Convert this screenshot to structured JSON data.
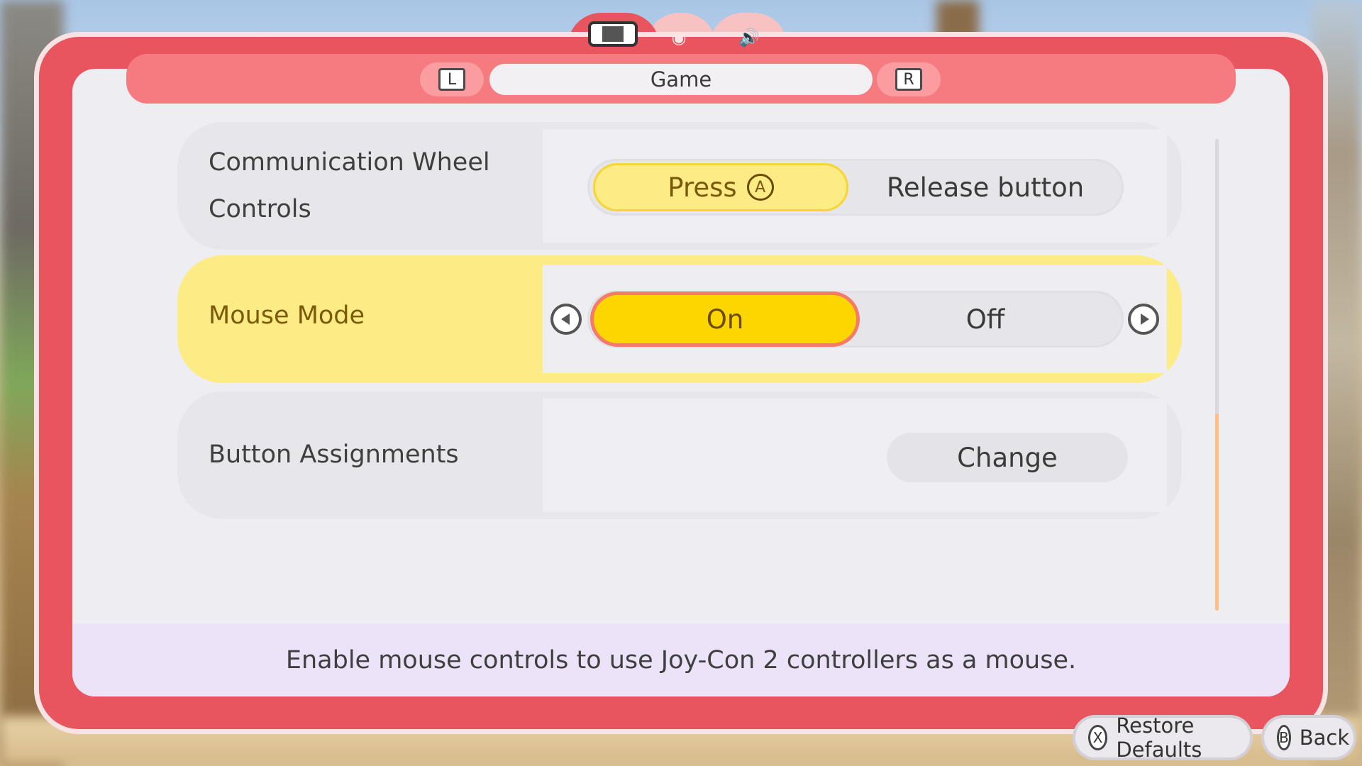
{
  "tabs": {
    "items": [
      {
        "name": "console-icon",
        "active": true
      },
      {
        "name": "camera-icon",
        "active": false
      },
      {
        "name": "sound-icon",
        "active": false
      }
    ]
  },
  "header": {
    "left_bumper": "L",
    "title": "Game",
    "right_bumper": "R"
  },
  "settings": {
    "rows": [
      {
        "label": "Communication Wheel Controls",
        "options": [
          "Press",
          "Release button"
        ],
        "selected": "Press",
        "option_button": "A"
      },
      {
        "label": "Mouse Mode",
        "options": [
          "On",
          "Off"
        ],
        "selected": "On",
        "focused": true
      },
      {
        "label": "Button Assignments",
        "action": "Change"
      }
    ]
  },
  "help": {
    "text": "Enable mouse controls to use Joy-Con 2 controllers as a mouse."
  },
  "footer": {
    "restore_key": "X",
    "restore_label": "Restore Defaults",
    "back_key": "B",
    "back_label": "Back"
  },
  "colors": {
    "frame": "#e8555e",
    "header": "#f67b80",
    "focus_row": "#fdeb86",
    "selected_on": "#fdd600",
    "help_bg": "#ece3f8",
    "scroll_thumb": "#fdbf86"
  }
}
